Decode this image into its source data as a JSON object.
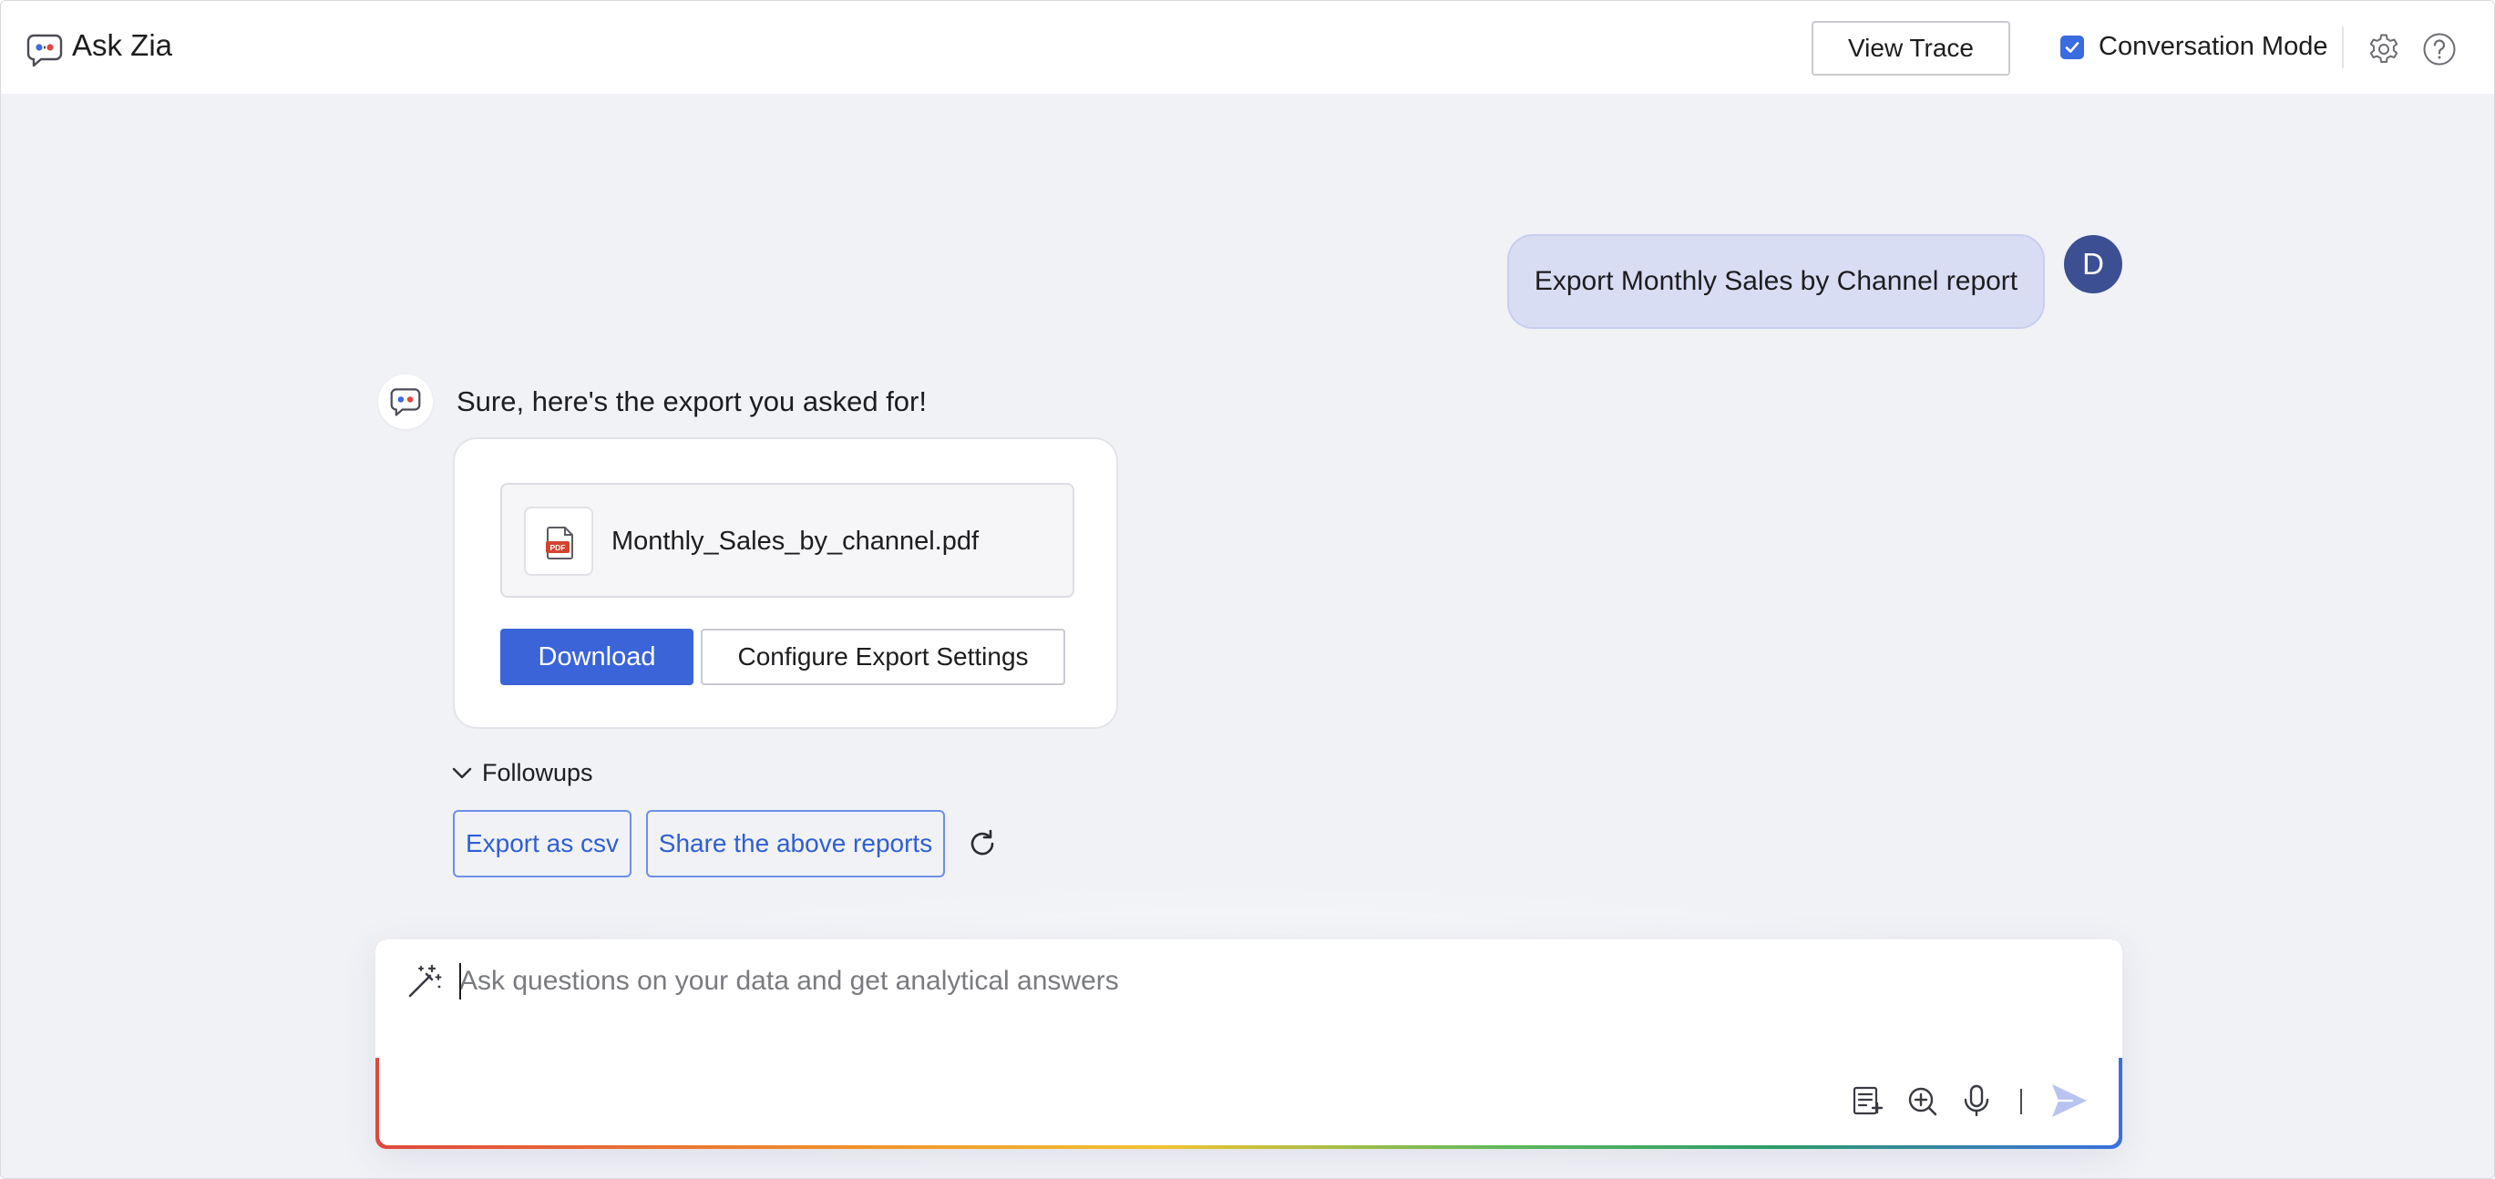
{
  "header": {
    "app_title": "Ask Zia",
    "view_trace_label": "View Trace",
    "conversation_mode_label": "Conversation Mode",
    "conversation_mode_checked": true,
    "icons": [
      "zia-logo-icon",
      "settings-icon",
      "help-icon"
    ]
  },
  "conversation": {
    "user_message": {
      "text": "Export Monthly Sales by Channel report",
      "avatar_initial": "D"
    },
    "assistant_message": {
      "text": "Sure, here's the export you asked for!",
      "attachment": {
        "file_name": "Monthly_Sales_by_channel.pdf",
        "file_icon": "pdf-file-icon"
      },
      "download_label": "Download",
      "configure_label": "Configure Export Settings"
    },
    "followups": {
      "label": "Followups",
      "expanded": true,
      "chips": [
        "Export as csv",
        "Share the above reports"
      ]
    }
  },
  "composer": {
    "placeholder": "Ask questions on your data and get analytical answers",
    "value": "",
    "icons": [
      "magic-wand-icon",
      "suggested-prompts-icon",
      "explore-icon",
      "microphone-icon",
      "send-icon"
    ]
  },
  "colors": {
    "accent": "#3a64d8",
    "user_bubble": "#d8ddf4",
    "avatar": "#3c4f92",
    "chip_text": "#2f5fd3",
    "background": "#f1f2f6"
  }
}
